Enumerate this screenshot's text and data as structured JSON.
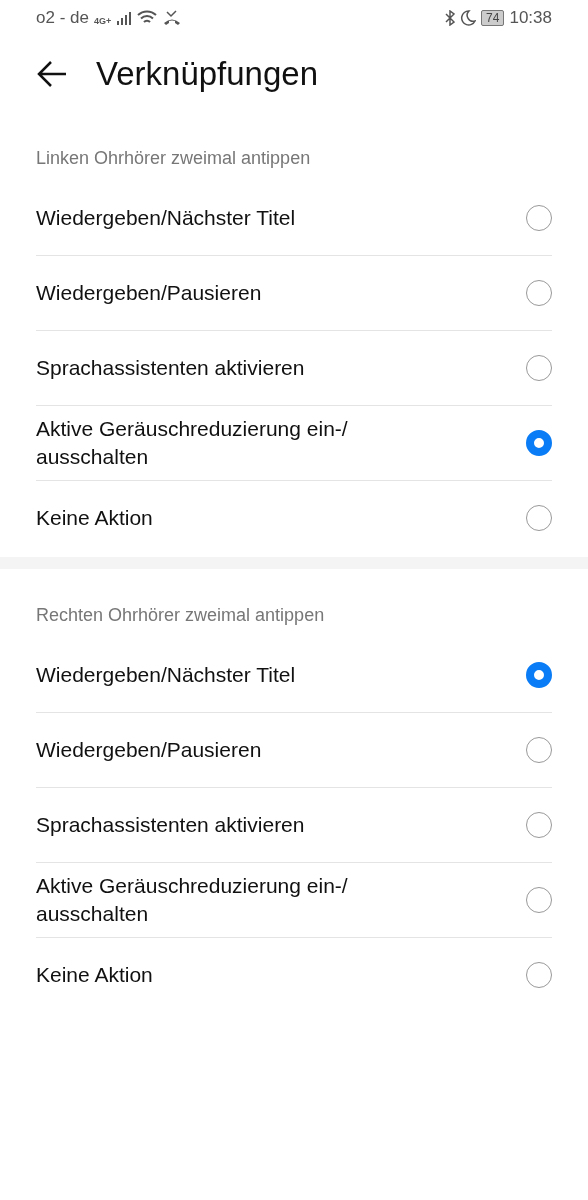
{
  "status_bar": {
    "carrier": "o2 - de",
    "network": "4G+",
    "battery": "74",
    "time": "10:38"
  },
  "title": "Verknüpfungen",
  "sections": [
    {
      "heading": "Linken Ohrhörer zweimal antippen",
      "options": [
        {
          "label": "Wiedergeben/Nächster Titel",
          "selected": false
        },
        {
          "label": "Wiedergeben/Pausieren",
          "selected": false
        },
        {
          "label": "Sprachassistenten aktivieren",
          "selected": false
        },
        {
          "label": "Aktive Geräuschreduzierung ein-/ ausschalten",
          "selected": true
        },
        {
          "label": "Keine Aktion",
          "selected": false
        }
      ]
    },
    {
      "heading": "Rechten Ohrhörer zweimal antippen",
      "options": [
        {
          "label": "Wiedergeben/Nächster Titel",
          "selected": true
        },
        {
          "label": "Wiedergeben/Pausieren",
          "selected": false
        },
        {
          "label": "Sprachassistenten aktivieren",
          "selected": false
        },
        {
          "label": "Aktive Geräuschreduzierung ein-/ ausschalten",
          "selected": false
        },
        {
          "label": "Keine Aktion",
          "selected": false
        }
      ]
    }
  ]
}
